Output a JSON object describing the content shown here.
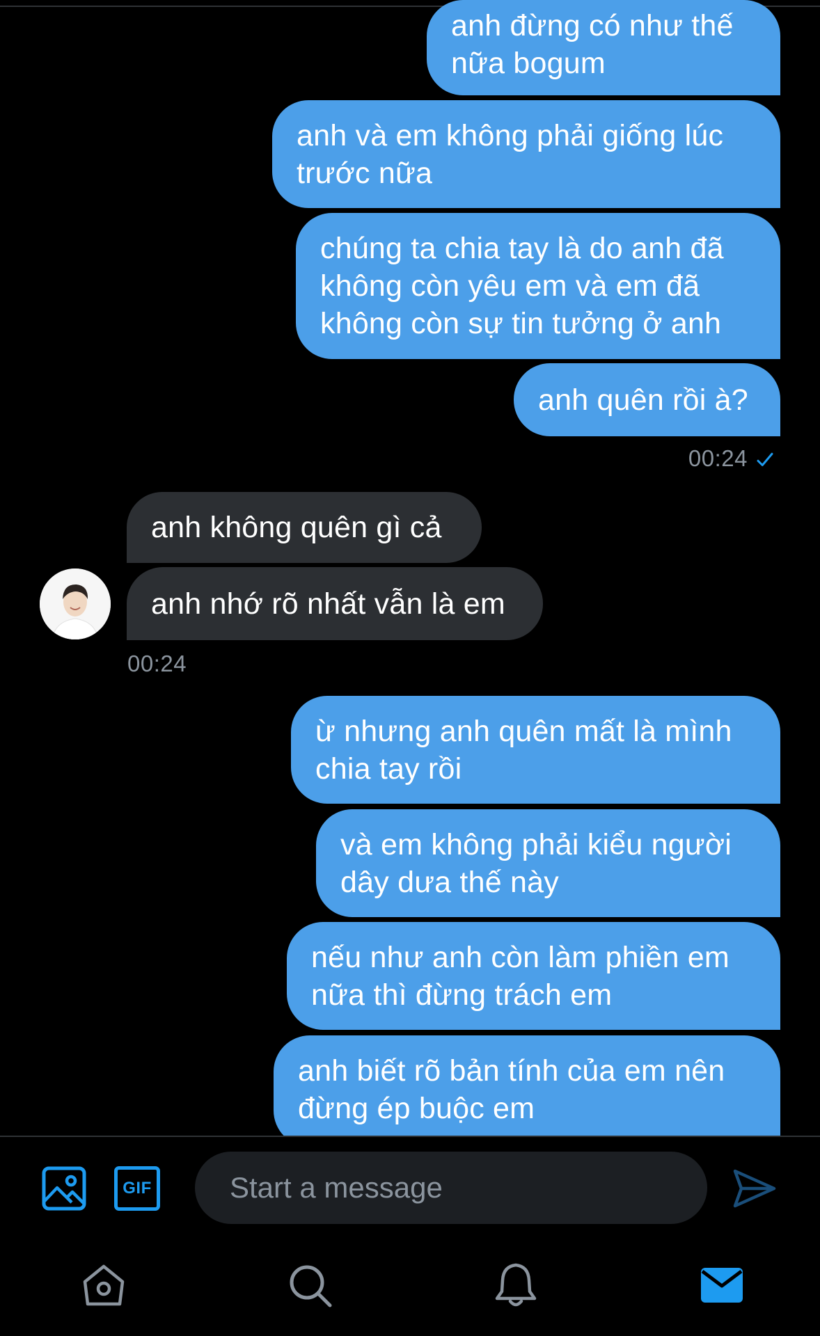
{
  "messages": {
    "m1": "anh đừng có như thế\nnữa bogum",
    "m2": "anh và em không phải giống lúc\ntrước nữa",
    "m3": "chúng ta chia tay là do anh đã\nkhông còn yêu em và em đã\nkhông còn sự tin tưởng ở anh",
    "m4": "anh quên rồi à?",
    "time1": "00:24",
    "r1": "anh không quên gì cả",
    "r2": "anh nhớ rõ nhất vẫn là em",
    "time2": "00:24",
    "m5": "ừ nhưng anh quên mất là mình\nchia tay rồi",
    "m6": "và em không phải kiểu người\ndây dưa thế này",
    "m7": "nếu như anh còn làm phiền em\nnữa thì đừng trách em",
    "m8": "anh biết rõ bản tính của em nên\nđừng ép buộc em"
  },
  "composer": {
    "placeholder": "Start a message",
    "gif_label": "GIF"
  },
  "icons": {
    "image": "image-icon",
    "gif": "gif-icon",
    "send": "send-icon",
    "home": "home-icon",
    "search": "search-icon",
    "notifications": "bell-icon",
    "messages": "mail-icon",
    "read_receipt": "checkmark-icon"
  },
  "colors": {
    "outgoing_bubble": "#4c9fe9",
    "incoming_bubble": "#2c2f33",
    "accent": "#1d9bf0",
    "background": "#000000",
    "muted_text": "#8b949e"
  }
}
